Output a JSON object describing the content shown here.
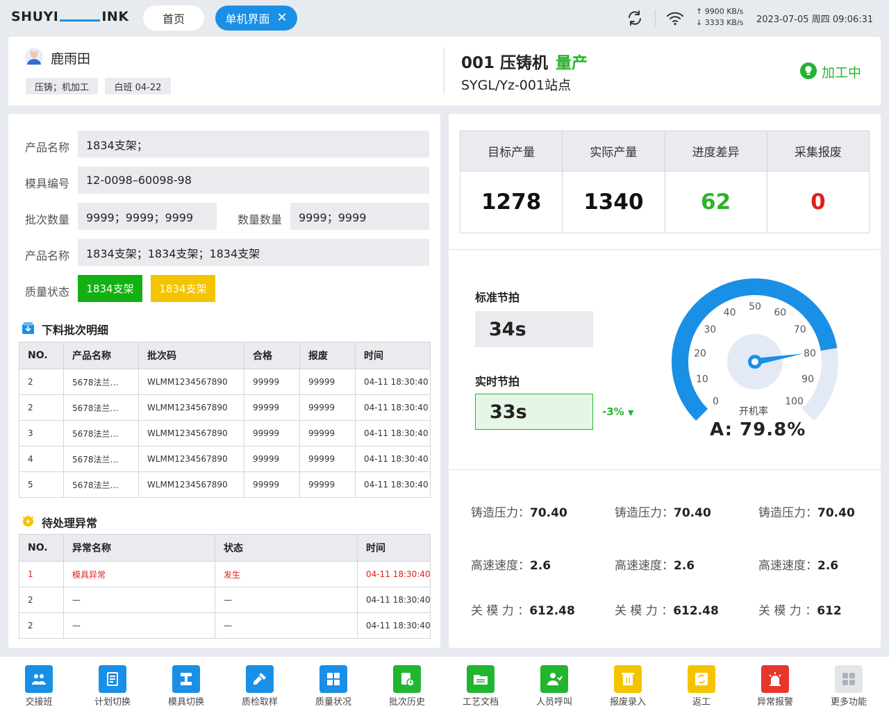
{
  "topbar": {
    "logo": {
      "left": "SHUYI",
      "right": "INK"
    },
    "tabs": [
      {
        "label": "首页"
      },
      {
        "label": "单机界面"
      }
    ],
    "net": {
      "up": "↑ 9900 KB/s",
      "down": "↓ 3333 KB/s"
    },
    "datetime": "2023-07-05  周四  09:06:31"
  },
  "header": {
    "user_name": "鹿雨田",
    "tags": [
      "压铸；机加工",
      "白班 04-22"
    ],
    "machine_name": "001 压铸机",
    "machine_mode": "量产",
    "station": "SYGL/Yz-001站点",
    "status": "加工中"
  },
  "form": {
    "product_label": "产品名称",
    "product_value": "1834支架；",
    "mold_label": "模具编号",
    "mold_value": "12-0098–60098-98",
    "batch_label": "批次数量",
    "batch_value": "9999；9999；9999",
    "qty_label": "数量数量",
    "qty_value": "9999；9999",
    "product2_label": "产品名称",
    "product2_value": "1834支架；1834支架；1834支架",
    "quality_label": "质量状态",
    "quality_badges": [
      "1834支架",
      "1834支架"
    ]
  },
  "batch_section": {
    "title": "下料批次明细",
    "headers": [
      "NO.",
      "产品名称",
      "批次码",
      "合格",
      "报废",
      "时间"
    ],
    "rows": [
      [
        "2",
        "5678法兰…",
        "WLMM1234567890",
        "99999",
        "99999",
        "04-11 18:30:40"
      ],
      [
        "2",
        "5678法兰…",
        "WLMM1234567890",
        "99999",
        "99999",
        "04-11 18:30:40"
      ],
      [
        "3",
        "5678法兰…",
        "WLMM1234567890",
        "99999",
        "99999",
        "04-11 18:30:40"
      ],
      [
        "4",
        "5678法兰…",
        "WLMM1234567890",
        "99999",
        "99999",
        "04-11 18:30:40"
      ],
      [
        "5",
        "5678法兰…",
        "WLMM1234567890",
        "99999",
        "99999",
        "04-11 18:30:40"
      ]
    ]
  },
  "exception_section": {
    "title": "待处理异常",
    "headers": [
      "NO.",
      "异常名称",
      "状态",
      "时间"
    ],
    "rows": [
      [
        "1",
        "模具异常",
        "发生",
        "04-11 18:30:40"
      ],
      [
        "2",
        "—",
        "—",
        "04-11 18:30:40"
      ],
      [
        "2",
        "—",
        "—",
        "04-11 18:30:40"
      ]
    ]
  },
  "kpi": {
    "headers": [
      "目标产量",
      "实际产量",
      "进度差异",
      "采集报废"
    ],
    "values": [
      "1278",
      "1340",
      "62",
      "0"
    ],
    "colors": [
      "#111111",
      "#111111",
      "#2cb329",
      "#e0201b"
    ]
  },
  "beat": {
    "std_label": "标准节拍",
    "std_value": "34s",
    "real_label": "实时节拍",
    "real_value": "33s",
    "delta": "-3%"
  },
  "gauge": {
    "ticks": [
      "0",
      "10",
      "20",
      "30",
      "40",
      "50",
      "60",
      "70",
      "80",
      "90",
      "100"
    ],
    "label": "开机率",
    "value_text": "A:  79.8%",
    "value": 79.8
  },
  "params": [
    {
      "label": "铸造压力：",
      "value": "70.40"
    },
    {
      "label": "铸造压力：",
      "value": "70.40"
    },
    {
      "label": "铸造压力：",
      "value": "70.40"
    },
    {
      "label": "高速速度：",
      "value": "2.6"
    },
    {
      "label": "高速速度：",
      "value": "2.6"
    },
    {
      "label": "高速速度：",
      "value": "2.6"
    },
    {
      "label": "关 模 力 ：",
      "value": "612.48"
    },
    {
      "label": "关 模 力 ：",
      "value": "612.48"
    },
    {
      "label": "关 模 力 ：",
      "value": "612"
    }
  ],
  "toolbar": [
    {
      "label": "交接班",
      "color": "#1a8fe6",
      "icon": "handover-icon"
    },
    {
      "label": "计划切换",
      "color": "#1a8fe6",
      "icon": "plan-icon"
    },
    {
      "label": "模具切换",
      "color": "#1a8fe6",
      "icon": "mold-icon"
    },
    {
      "label": "质检取样",
      "color": "#1a8fe6",
      "icon": "inspect-icon"
    },
    {
      "label": "质量状况",
      "color": "#1a8fe6",
      "icon": "quality-icon"
    },
    {
      "label": "批次历史",
      "color": "#22b530",
      "icon": "history-icon"
    },
    {
      "label": "工艺文档",
      "color": "#22b530",
      "icon": "folder-icon"
    },
    {
      "label": "人员呼叫",
      "color": "#22b530",
      "icon": "call-icon"
    },
    {
      "label": "报废录入",
      "color": "#f5c400",
      "icon": "scrap-icon"
    },
    {
      "label": "返工",
      "color": "#f5c400",
      "icon": "rework-icon"
    },
    {
      "label": "异常报警",
      "color": "#e8362f",
      "icon": "alarm-icon"
    },
    {
      "label": "更多功能",
      "color": "#e3e6e9",
      "icon": "more-icon"
    }
  ]
}
